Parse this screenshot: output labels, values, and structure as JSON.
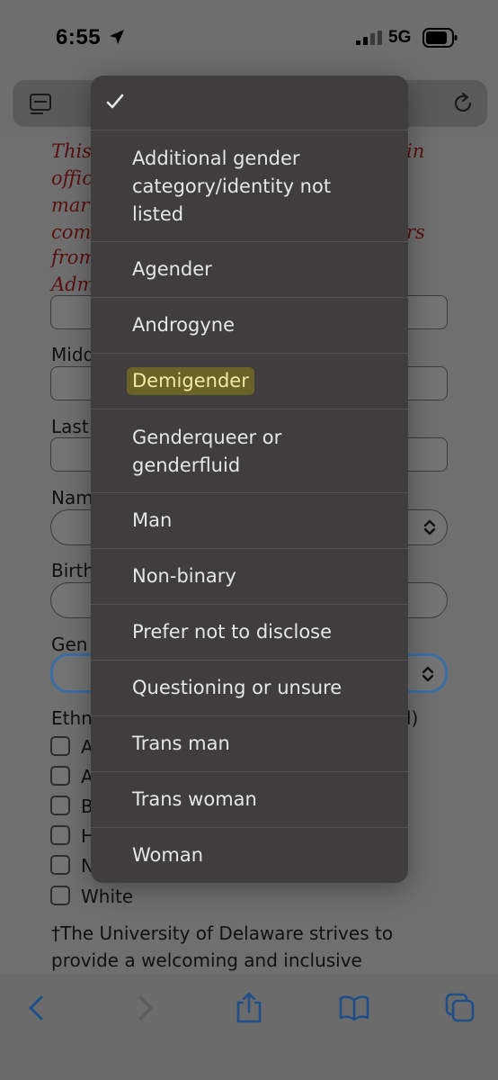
{
  "status": {
    "time": "6:55",
    "network": "5G"
  },
  "page": {
    "note_lines": [
      "This",
      "offic",
      "marr",
      "com",
      "from",
      "Adm"
    ],
    "note_right": [
      "in",
      "rs"
    ],
    "labels": {
      "middle": "Midd",
      "last": "Last",
      "name": "Nam",
      "birth": "Birth",
      "gender": "Gen",
      "ethnicity": "Ethni",
      "ethnicity_right": "l)"
    },
    "checkboxes": [
      "A",
      "A",
      "B",
      "H",
      "N",
      "White"
    ],
    "footnote": "†The University of Delaware strives to provide a welcoming and inclusive"
  },
  "menu": {
    "selected_mark": "✓",
    "items": [
      "Additional gender category/identity not listed",
      "Agender",
      "Androgyne",
      "Demigender",
      "Genderqueer or genderfluid",
      "Man",
      "Non-binary",
      "Prefer not to disclose",
      "Questioning or unsure",
      "Trans man",
      "Trans woman",
      "Woman"
    ],
    "highlighted": "Demigender"
  },
  "colors": {
    "menu_bg": "#3f3d3d",
    "highlight_bg": "#6a6328",
    "focus_border": "#3b6ea5"
  },
  "icons": [
    "location-arrow-icon",
    "signal-icon",
    "battery-icon",
    "reader-icon",
    "reload-icon",
    "back-icon",
    "forward-icon",
    "share-icon",
    "bookmarks-icon",
    "tabs-icon",
    "checkmark-icon",
    "chevron-updown-icon"
  ]
}
